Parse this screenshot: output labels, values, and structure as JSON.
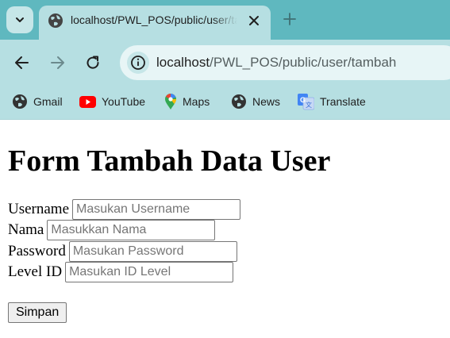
{
  "browser": {
    "tab": {
      "title": "localhost/PWL_POS/public/user/tambah"
    },
    "address_bar": {
      "host": "localhost",
      "path": "/PWL_POS/public/user/tambah"
    },
    "bookmarks": [
      {
        "label": "Gmail",
        "icon": "globe-icon"
      },
      {
        "label": "YouTube",
        "icon": "youtube-icon"
      },
      {
        "label": "Maps",
        "icon": "maps-pin-icon"
      },
      {
        "label": "News",
        "icon": "globe-icon"
      },
      {
        "label": "Translate",
        "icon": "translate-icon"
      }
    ],
    "colors": {
      "tabstrip": "#5fb8bf",
      "toolbar": "#b6dfe2",
      "omnibox": "#e7f5f6"
    }
  },
  "page": {
    "heading": "Form Tambah Data User",
    "fields": [
      {
        "label": "Username",
        "placeholder": "Masukan Username",
        "value": ""
      },
      {
        "label": "Nama",
        "placeholder": "Masukkan Nama",
        "value": ""
      },
      {
        "label": "Password",
        "placeholder": "Masukan Password",
        "value": ""
      },
      {
        "label": "Level ID",
        "placeholder": "Masukan ID Level",
        "value": ""
      }
    ],
    "submit_label": "Simpan"
  }
}
